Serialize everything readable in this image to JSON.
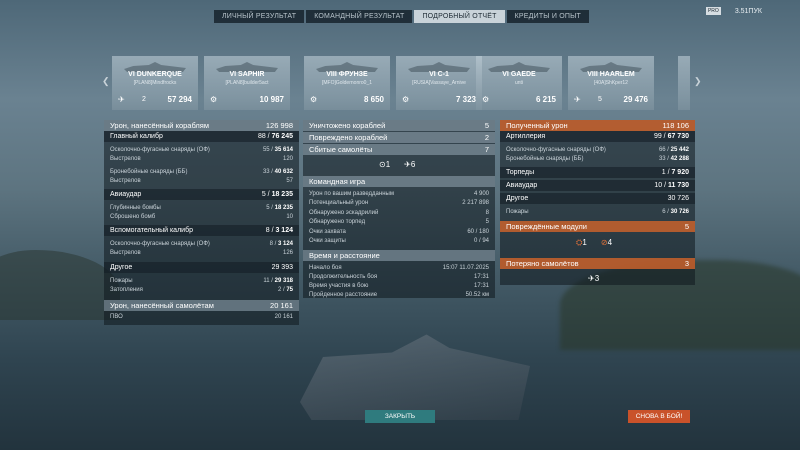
{
  "tabs": [
    "ЛИЧНЫЙ РЕЗУЛЬТАТ",
    "КОМАНДНЫЙ РЕЗУЛЬТАТ",
    "ПОДРОБНЫЙ ОТЧЁТ",
    "КРЕДИТЫ И ОПЫТ"
  ],
  "corner": {
    "badge": "PRO",
    "points": "3.51ПУК"
  },
  "ships": [
    {
      "name": "VI DUNKERQUE",
      "player": "[PLAN8]Mindfrocks",
      "kills": "2",
      "damage": "57 294"
    },
    {
      "name": "VI SAPHIR",
      "player": "[PLAN8]builder5act",
      "kills": "",
      "damage": "10 987"
    },
    {
      "name": "VIII ФРУНЗЕ",
      "player": "[MFO]Goldernonro0_1",
      "kills": "",
      "damage": "8 650"
    },
    {
      "name": "VI C-1",
      "player": "[RUSIA]Vassaye_Arnive",
      "kills": "",
      "damage": "7 323"
    },
    {
      "name": "VI GAEDE",
      "player": "unti",
      "kills": "",
      "damage": "6 215"
    },
    {
      "name": "VIII HAARLEM",
      "player": "[40A]ShKper12",
      "kills": "5",
      "damage": "29 476"
    }
  ],
  "left": {
    "h1": {
      "l": "Урон, нанесённый кораблям",
      "v": "126 998"
    },
    "main": {
      "l": "Главный калибр",
      "v1": "88",
      "v2": "76 245"
    },
    "he1": {
      "l": "Осколочно-фугасные снаряды (ОФ)",
      "v1": "55",
      "v2": "35 614"
    },
    "shots1": {
      "l": "Выстрелов",
      "v": "120"
    },
    "ap1": {
      "l": "Бронебойные снаряды (ББ)",
      "v1": "33",
      "v2": "40 632"
    },
    "shots2": {
      "l": "Выстрелов",
      "v": "57"
    },
    "air": {
      "l": "Авиаудар",
      "v1": "5",
      "v2": "18 235"
    },
    "depth": {
      "l": "Глубинные бомбы",
      "v1": "5",
      "v2": "18 235"
    },
    "drop": {
      "l": "Сброшено бомб",
      "v": "10"
    },
    "sec": {
      "l": "Вспомогательный калибр",
      "v1": "8",
      "v2": "3 124"
    },
    "he2": {
      "l": "Осколочно-фугасные снаряды (ОФ)",
      "v1": "8",
      "v2": "3 124"
    },
    "shots3": {
      "l": "Выстрелов",
      "v": "126"
    },
    "other": {
      "l": "Другое",
      "v": "29 393"
    },
    "fires": {
      "l": "Пожары",
      "v1": "11",
      "v2": "29 318"
    },
    "flood": {
      "l": "Затопления",
      "v1": "2",
      "v2": "75"
    },
    "h2": {
      "l": "Урон, нанесённый самолётам",
      "v": "20 161"
    },
    "aa": {
      "l": "ПВО",
      "v": "20 161"
    }
  },
  "mid": {
    "destroyed": {
      "l": "Уничтожено кораблей",
      "v": "5"
    },
    "damaged": {
      "l": "Повреждено кораблей",
      "v": "2"
    },
    "planes": {
      "l": "Сбитые самолёты",
      "v": "7"
    },
    "icon_a": "1",
    "icon_b": "6",
    "team": "Командная игра",
    "spot": {
      "l": "Урон по вашим разведданным",
      "v": "4 900"
    },
    "pot": {
      "l": "Потенциальный урон",
      "v": "2 217 898"
    },
    "det_sq": {
      "l": "Обнаружено эскадрилий",
      "v": "8"
    },
    "det_t": {
      "l": "Обнаружено торпед",
      "v": "5"
    },
    "cap": {
      "l": "Очки захвата",
      "v": "60 / 180"
    },
    "def": {
      "l": "Очки защиты",
      "v": "0 / 94"
    },
    "time": "Время и расстояние",
    "start": {
      "l": "Начало боя",
      "v": "15:07  11.07.2025"
    },
    "dur": {
      "l": "Продолжительность боя",
      "v": "17:31"
    },
    "part": {
      "l": "Время участия в бою",
      "v": "17:31"
    },
    "dist": {
      "l": "Пройденное расстояние",
      "v": "50.52 км"
    }
  },
  "right": {
    "recv": {
      "l": "Полученный урон",
      "v": "118 106"
    },
    "art": {
      "l": "Артиллерия",
      "v1": "99",
      "v2": "67 730"
    },
    "he": {
      "l": "Осколочно-фугасные снаряды (ОФ)",
      "v1": "66",
      "v2": "25 442"
    },
    "ap": {
      "l": "Бронебойные снаряды (ББ)",
      "v1": "33",
      "v2": "42 288"
    },
    "torp": {
      "l": "Торпеды",
      "v1": "1",
      "v2": "7 920"
    },
    "air": {
      "l": "Авиаудар",
      "v1": "10",
      "v2": "11 730"
    },
    "other": {
      "l": "Другое",
      "v": "30 726"
    },
    "fires": {
      "l": "Пожары",
      "v1": "6",
      "v2": "30 726"
    },
    "mods": {
      "l": "Повреждённые модули",
      "v": "5"
    },
    "mod_a": "1",
    "mod_b": "4",
    "lost": {
      "l": "Потеряно самолётов",
      "v": "3"
    },
    "lost_icon": "3"
  },
  "buttons": {
    "close": "ЗАКРЫТЬ",
    "again": "СНОВА В БОЙ!"
  }
}
